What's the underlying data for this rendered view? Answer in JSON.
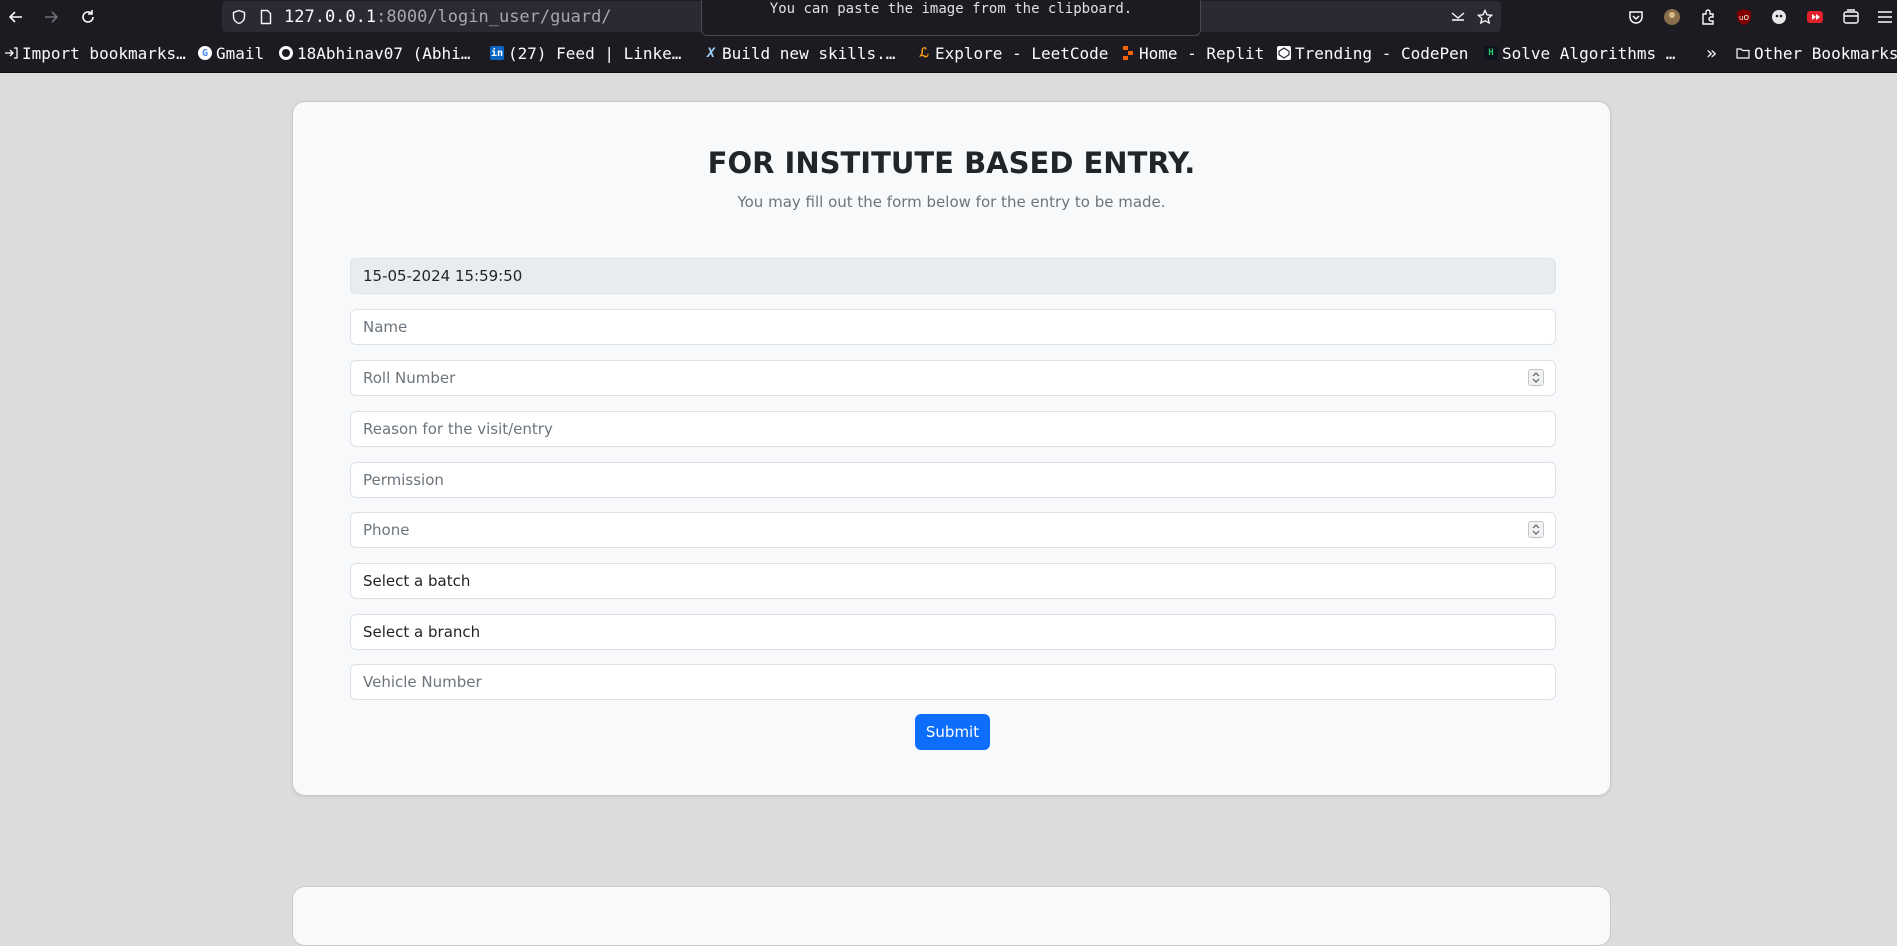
{
  "browser": {
    "url_host": "127.0.0.1",
    "url_port": ":8000",
    "url_path": "/login_user/guard/",
    "tooltip": "You can paste the image from the clipboard."
  },
  "bookmarks": {
    "items": [
      {
        "label": "Import bookmarks…",
        "icon": "import-icon"
      },
      {
        "label": "Gmail",
        "icon": "google-icon"
      },
      {
        "label": "18Abhinav07 (Abhi…",
        "icon": "github-icon"
      },
      {
        "label": "(27) Feed | Linke…",
        "icon": "linkedin-icon"
      },
      {
        "label": "Build new skills.…",
        "icon": "x-icon"
      },
      {
        "label": "Explore - LeetCode",
        "icon": "leetcode-icon"
      },
      {
        "label": "Home - Replit",
        "icon": "replit-icon"
      },
      {
        "label": "Trending - CodePen",
        "icon": "codepen-icon"
      },
      {
        "label": "Solve Algorithms …",
        "icon": "hackerrank-icon"
      }
    ],
    "overflow": "»",
    "other": "Other Bookmarks"
  },
  "form": {
    "title": "FOR INSTITUTE BASED ENTRY.",
    "subtitle": "You may fill out the form below for the entry to be made.",
    "datetime": "15-05-2024 15:59:50",
    "name_placeholder": "Name",
    "roll_placeholder": "Roll Number",
    "reason_placeholder": "Reason for the visit/entry",
    "permission_placeholder": "Permission",
    "phone_placeholder": "Phone",
    "batch_select": "Select a batch",
    "branch_select": "Select a branch",
    "vehicle_placeholder": "Vehicle Number",
    "submit_label": "Submit"
  },
  "colors": {
    "primary": "#0d6efd",
    "toolbar_bg": "#1c1b22",
    "page_bg": "#dcdcdc"
  }
}
